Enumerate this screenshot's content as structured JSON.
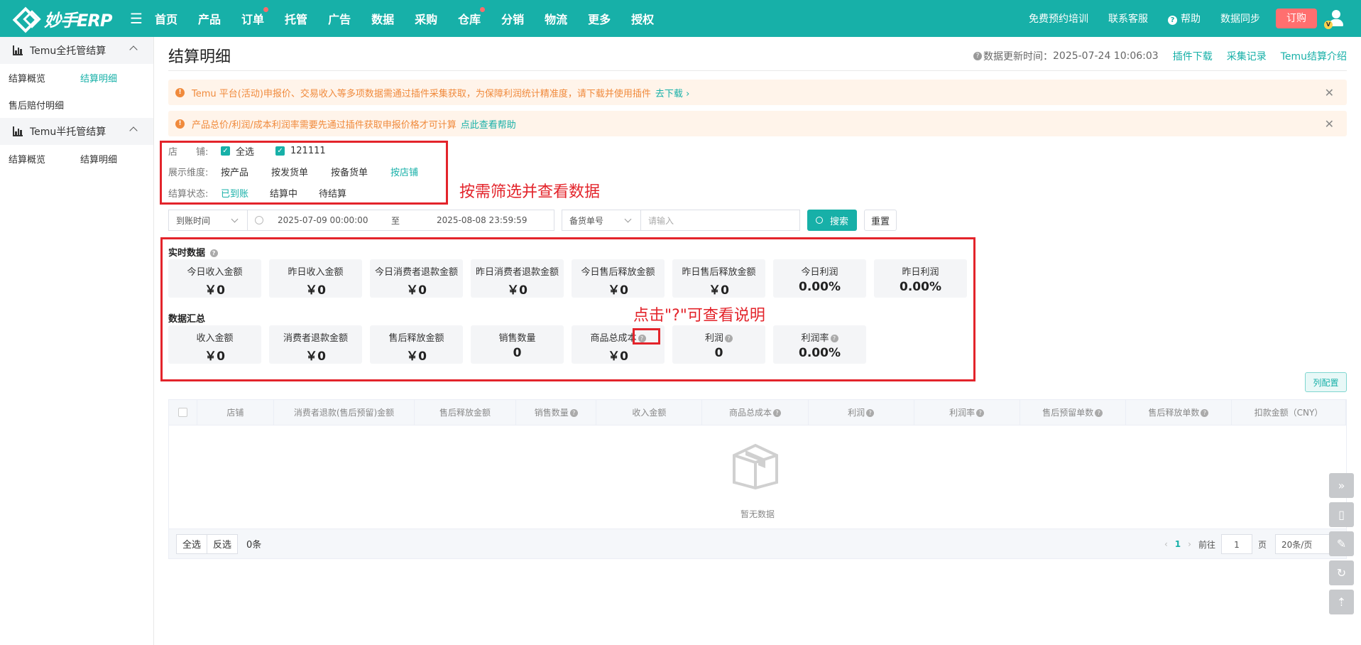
{
  "topbar": {
    "logo_text": "妙手ERP",
    "nav": [
      {
        "label": "首页",
        "dot": false
      },
      {
        "label": "产品",
        "dot": false
      },
      {
        "label": "订单",
        "dot": true
      },
      {
        "label": "托管",
        "dot": false
      },
      {
        "label": "广告",
        "dot": false
      },
      {
        "label": "数据",
        "dot": false
      },
      {
        "label": "采购",
        "dot": false
      },
      {
        "label": "仓库",
        "dot": true
      },
      {
        "label": "分销",
        "dot": false
      },
      {
        "label": "物流",
        "dot": false
      },
      {
        "label": "更多",
        "dot": false
      },
      {
        "label": "授权",
        "dot": false
      }
    ],
    "right_links": {
      "training": "免费预约培训",
      "support": "联系客服",
      "help": "帮助",
      "sync": "数据同步",
      "order": "订购"
    },
    "avatar_badge": "V"
  },
  "sidebar": {
    "group1": {
      "title": "Temu全托管结算",
      "items": [
        "结算概览",
        "结算明细",
        "售后赔付明细"
      ],
      "active": "结算明细"
    },
    "group2": {
      "title": "Temu半托管结算",
      "items": [
        "结算概览",
        "结算明细"
      ]
    }
  },
  "page": {
    "title": "结算明细",
    "update_label": "数据更新时间：",
    "update_time": "2025-07-24 10:06:03",
    "links": [
      "插件下载",
      "采集记录",
      "Temu结算介绍"
    ]
  },
  "alerts": [
    {
      "text": "Temu 平台(活动)申报价、交易收入等多项数据需通过插件采集获取，为保障利润统计精准度，请下载并使用插件",
      "link": "去下载"
    },
    {
      "text": "产品总价/利润/成本利润率需要先通过插件获取申报价格才可计算",
      "link": "点此查看帮助"
    }
  ],
  "filters": {
    "store_label": "店　　铺:",
    "store_options": [
      "全选",
      "121111"
    ],
    "dimension_label": "展示维度:",
    "dimension_options": [
      "按产品",
      "按发货单",
      "按备货单",
      "按店铺"
    ],
    "dimension_active": "按店铺",
    "status_label": "结算状态:",
    "status_options": [
      "已到账",
      "结算中",
      "待结算"
    ],
    "status_active": "已到账"
  },
  "annotations": {
    "filter_note": "按需筛选并查看数据",
    "help_note": "点击\"?\"可查看说明"
  },
  "search": {
    "time_type": "到账时间",
    "start": "2025-07-09 00:00:00",
    "to": "至",
    "end": "2025-08-08 23:59:59",
    "field": "备货单号",
    "placeholder": "请输入",
    "search_btn": "搜索",
    "reset_btn": "重置"
  },
  "realtime": {
    "title": "实时数据",
    "cards": [
      {
        "label": "今日收入金额",
        "value": "￥0"
      },
      {
        "label": "昨日收入金额",
        "value": "￥0"
      },
      {
        "label": "今日消费者退款金额",
        "value": "￥0"
      },
      {
        "label": "昨日消费者退款金额",
        "value": "￥0"
      },
      {
        "label": "今日售后释放金额",
        "value": "￥0"
      },
      {
        "label": "昨日售后释放金额",
        "value": "￥0"
      },
      {
        "label": "今日利润",
        "value": "0.00%"
      },
      {
        "label": "昨日利润",
        "value": "0.00%"
      }
    ]
  },
  "summary": {
    "title": "数据汇总",
    "cards": [
      {
        "label": "收入金额",
        "value": "￥0",
        "help": false
      },
      {
        "label": "消费者退款金额",
        "value": "￥0",
        "help": false
      },
      {
        "label": "售后释放金额",
        "value": "￥0",
        "help": false
      },
      {
        "label": "销售数量",
        "value": "0",
        "help": false
      },
      {
        "label": "商品总成本",
        "value": "￥0",
        "help": true
      },
      {
        "label": "利润",
        "value": "0",
        "help": true
      },
      {
        "label": "利润率",
        "value": "0.00%",
        "help": true
      }
    ]
  },
  "table": {
    "col_config": "列配置",
    "columns": [
      {
        "label": "店铺",
        "help": false
      },
      {
        "label": "消费者退款(售后预留)金额",
        "help": false
      },
      {
        "label": "售后释放金额",
        "help": false
      },
      {
        "label": "销售数量",
        "help": true
      },
      {
        "label": "收入金额",
        "help": false
      },
      {
        "label": "商品总成本",
        "help": true
      },
      {
        "label": "利润",
        "help": true
      },
      {
        "label": "利润率",
        "help": true
      },
      {
        "label": "售后预留单数",
        "help": true
      },
      {
        "label": "售后释放单数",
        "help": true
      },
      {
        "label": "扣款金额（CNY）",
        "help": false
      }
    ],
    "empty_text": "暂无数据",
    "footer": {
      "select_all": "全选",
      "invert": "反选",
      "count": "0条"
    },
    "pager": {
      "current": "1",
      "goto_label": "前往",
      "goto_value": "1",
      "page_unit": "页",
      "page_size": "20条/页"
    }
  }
}
